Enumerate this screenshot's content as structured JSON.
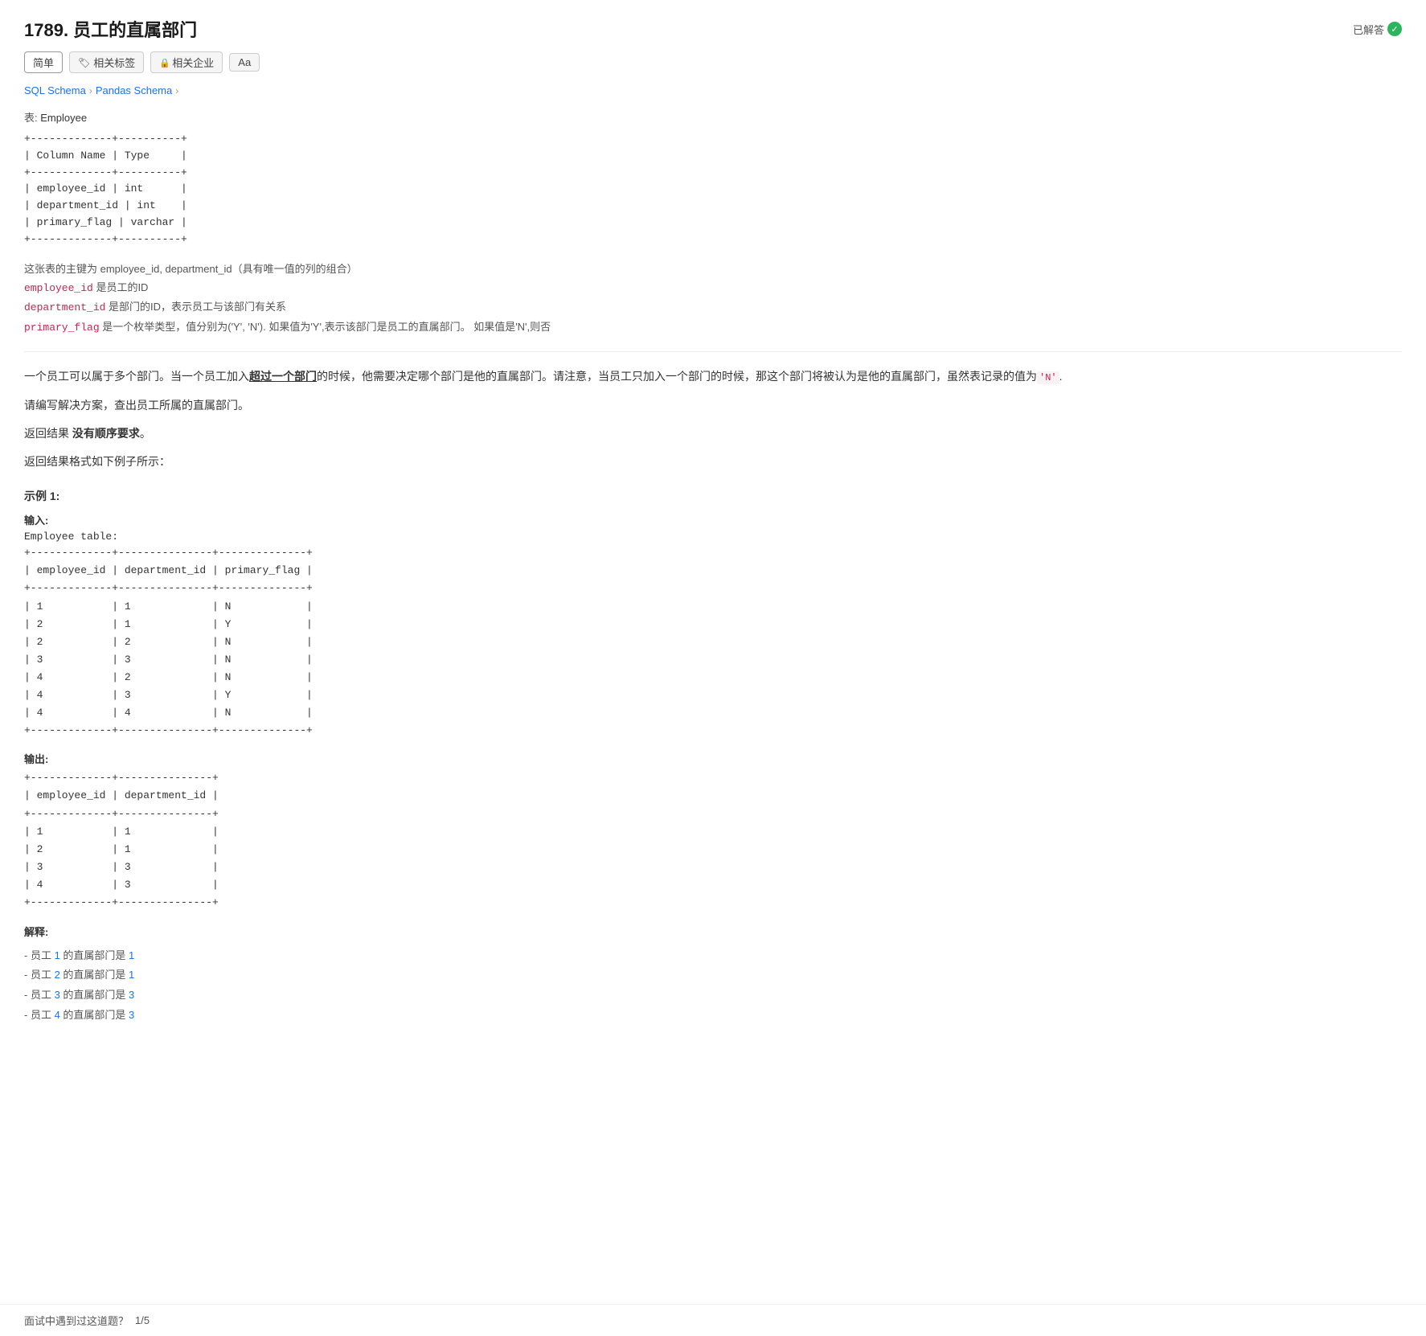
{
  "page": {
    "title": "1789. 员工的直属部门",
    "solved_label": "已解答",
    "tabs": [
      {
        "label": "简单",
        "icon": ""
      },
      {
        "label": "相关标签",
        "icon": "🏷"
      },
      {
        "label": "相关企业",
        "icon": "🔒"
      },
      {
        "label": "Aa",
        "icon": ""
      }
    ],
    "schema_nav": [
      {
        "label": "SQL Schema",
        "active": false
      },
      {
        "label": "Pandas Schema",
        "active": false
      }
    ],
    "table_name": "Employee",
    "schema_display": "+-------------+----------+\n| Column Name | Type     |\n+-------------+----------+\n| employee_id | int      |\n| department_id | int    |\n| primary_flag | varchar |\n+-------------+----------+",
    "description": [
      "这张表的主键为 employee_id, department_id（具有唯一值的列的组合）",
      "employee_id 是员工的ID",
      "department_id 是部门的ID，表示员工与该部门有关系",
      "primary_flag 是一个枚举类型，值分别为('Y', 'N'). 如果值为'Y',表示该部门是员工的直属部门。 如果值是'N',则否"
    ],
    "problem_text_1": "一个员工可以属于多个部门。当一个员工加入",
    "bold_part": "超过一个部门",
    "problem_text_2": "的时候，他需要决定哪个部门是他的直属部门。请注意，当员工只加入一个部门的时候，那这个部门将被认为是他的直属部门，虽然表记录的值为",
    "highlight_n": "'N'",
    "problem_text_3": ".",
    "problem_text_line2": "请编写解决方案，查出员工所属的直属部门。",
    "no_order_text": "返回结果 没有顺序要求。",
    "format_text": "返回结果格式如下例子所示：",
    "example_title": "示例 1:",
    "input_label": "输入:",
    "input_table_name": "Employee table:",
    "input_table": "+-------------+---------------+--------------+\n| employee_id | department_id | primary_flag |\n+-------------+---------------+--------------+\n| 1           | 1             | N            |\n| 2           | 1             | Y            |\n| 2           | 2             | N            |\n| 3           | 3             | N            |\n| 4           | 2             | N            |\n| 4           | 3             | Y            |\n| 4           | 4             | N            |\n+-------------+---------------+--------------+",
    "output_label": "输出:",
    "output_table": "+-------------+---------------+\n| employee_id | department_id |\n+-------------+---------------+\n| 1           | 1             |\n| 2           | 1             |\n| 3           | 3             |\n| 4           | 3             |\n+-------------+---------------+",
    "explanation_title": "解释:",
    "explanation_lines": [
      "- 员工 1 的直属部门是 1",
      "- 员工 2 的直属部门是 1",
      "- 员工 3 的直属部门是 3",
      "- 员工 4 的直属部门是 3"
    ],
    "footer_text": "面试中遇到过这道题？",
    "footer_count": "1/5"
  }
}
